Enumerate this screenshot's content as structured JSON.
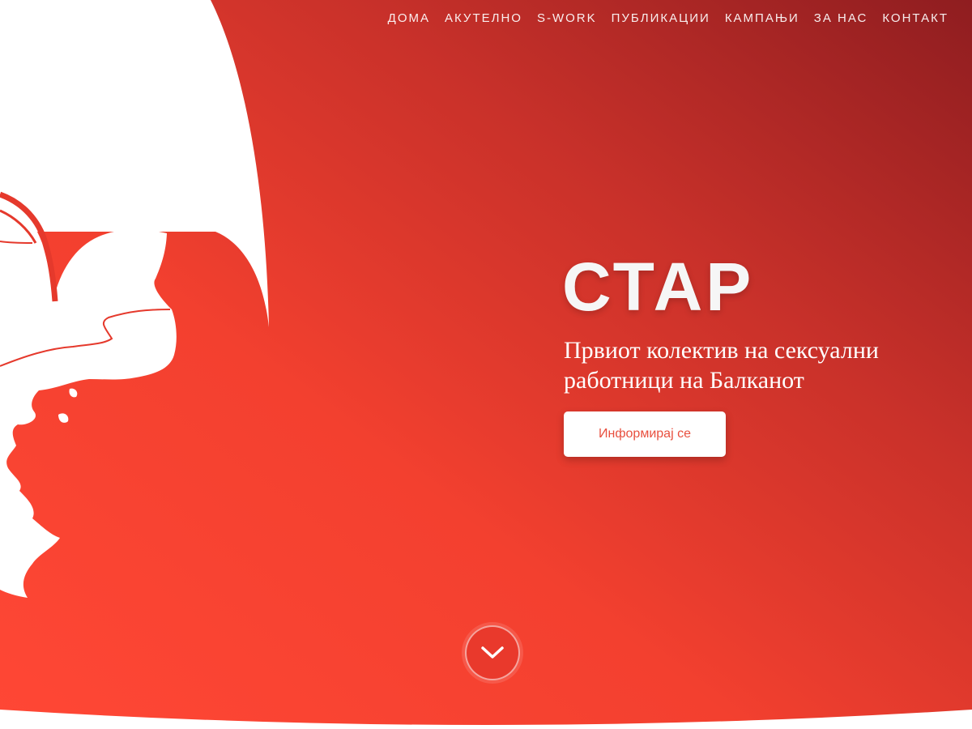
{
  "nav": {
    "items": [
      {
        "label": "ДОМА"
      },
      {
        "label": "АКУТЕЛНО"
      },
      {
        "label": "S-WORK"
      },
      {
        "label": "ПУБЛИКАЦИИ"
      },
      {
        "label": "КАМПАЊИ"
      },
      {
        "label": "ЗА НАС"
      },
      {
        "label": "КОНТАКТ"
      }
    ]
  },
  "hero": {
    "brand": "СТАР",
    "tagline": "Првиот колектив на сексуални работници на Балканот",
    "cta_label": "Информирај се",
    "scroll_icon": "chevron-down-icon",
    "logo_icon": "balkan-map-logo"
  },
  "colors": {
    "gradient_light": "#fe4535",
    "gradient_mid": "#d9372d",
    "gradient_dark": "#901d20",
    "button_text": "#e8503f",
    "white": "#ffffff"
  }
}
